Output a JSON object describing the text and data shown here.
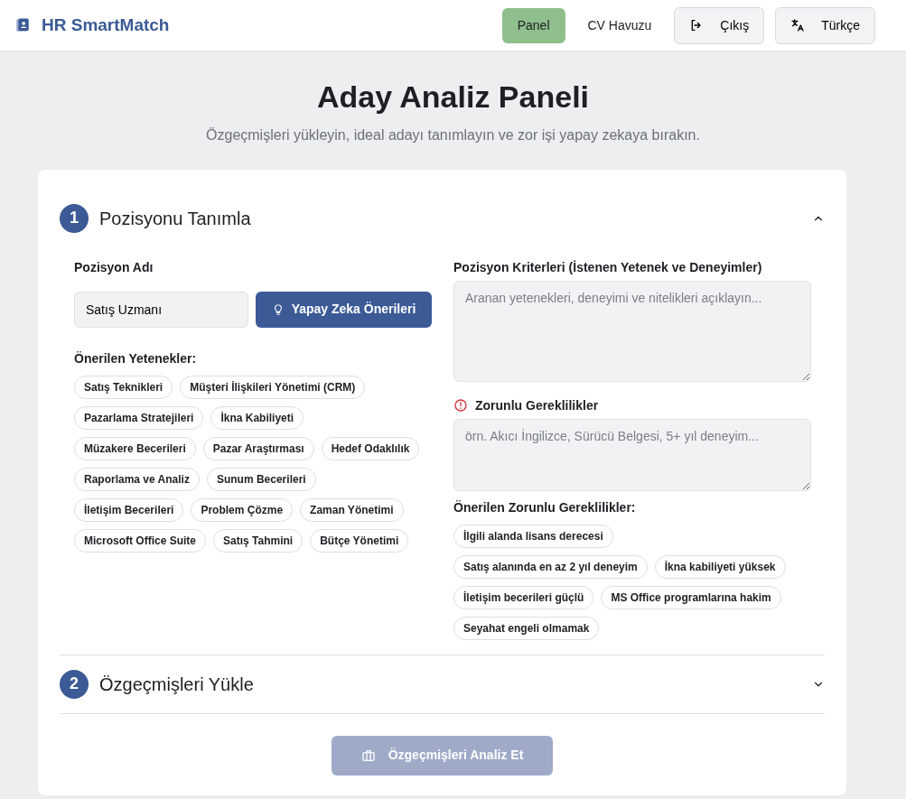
{
  "brand": {
    "name": "HR SmartMatch"
  },
  "nav": [
    {
      "label": "Panel",
      "kind": "link",
      "selected": true
    },
    {
      "label": "CV Havuzu",
      "kind": "link",
      "selected": false
    },
    {
      "label": "Çıkış",
      "kind": "logout",
      "selected": false
    },
    {
      "label": "Türkçe",
      "kind": "language",
      "selected": false
    }
  ],
  "header": {
    "title": "Aday Analiz Paneli",
    "subtitle": "Özgeçmişleri yükleyin, ideal adayı tanımlayın ve zor işi yapay zekaya bırakın."
  },
  "sections": [
    {
      "number": "1",
      "title": "Pozisyonu Tanımla",
      "expanded": true
    },
    {
      "number": "2",
      "title": "Özgeçmişleri Yükle",
      "expanded": false
    }
  ],
  "position_form": {
    "name_label": "Pozisyon Adı",
    "name_value": "Satış Uzmanı",
    "ai_button": "Yapay Zeka Önerileri",
    "skills_label": "Önerilen Yetenekler:",
    "skills": [
      "Satış Teknikleri",
      "Müşteri İlişkileri Yönetimi (CRM)",
      "Pazarlama Stratejileri",
      "İkna Kabiliyeti",
      "Müzakere Becerileri",
      "Pazar Araştırması",
      "Hedef Odaklılık",
      "Raporlama ve Analiz",
      "Sunum Becerileri",
      "İletişim Becerileri",
      "Problem Çözme",
      "Zaman Yönetimi",
      "Microsoft Office Suite",
      "Satış Tahmini",
      "Bütçe Yönetimi"
    ],
    "criteria_label": "Pozisyon Kriterleri (İstenen Yetenek ve Deneyimler)",
    "criteria_placeholder": "Aranan yetenekleri, deneyimi ve nitelikleri açıklayın...",
    "required_label": "Zorunlu Gereklilikler",
    "required_placeholder": "örn. Akıcı İngilizce, Sürücü Belgesi, 5+ yıl deneyim...",
    "required_suggestions_label": "Önerilen Zorunlu Gereklilikler:",
    "required_suggestions": [
      "İlgili alanda lisans derecesi",
      "Satış alanında en az 2 yıl deneyim",
      "İkna kabiliyeti yüksek",
      "İletişim becerileri güçlü",
      "MS Office programlarına hakim",
      "Seyahat engeli olmamak"
    ]
  },
  "analyze_button": {
    "label": "Özgeçmişleri Analiz Et",
    "disabled": true
  }
}
